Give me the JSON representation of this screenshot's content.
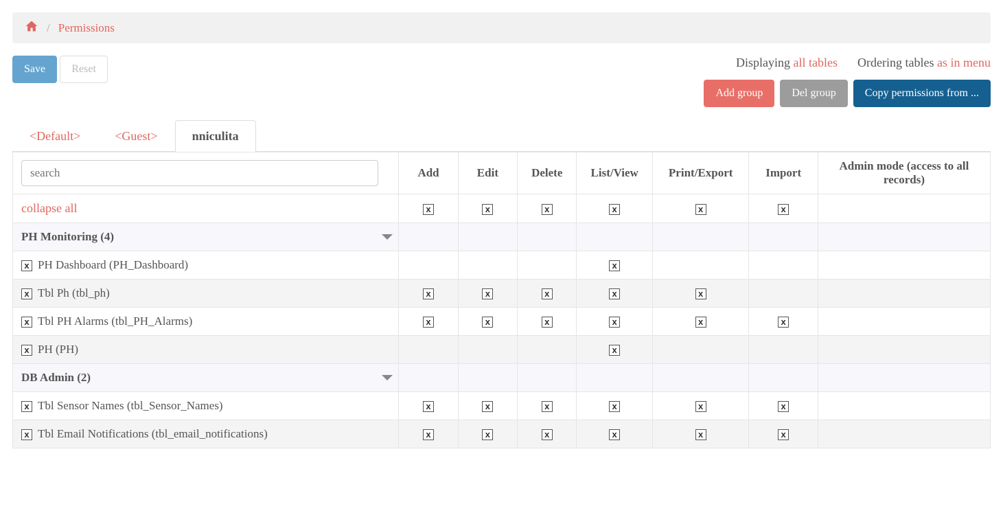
{
  "breadcrumb": {
    "current": "Permissions"
  },
  "toolbar": {
    "save": "Save",
    "reset": "Reset"
  },
  "status": {
    "displaying_label": "Displaying ",
    "displaying_value": "all tables",
    "ordering_label": "Ordering tables ",
    "ordering_value": "as in menu"
  },
  "actions": {
    "add_group": "Add group",
    "del_group": "Del group",
    "copy_from": "Copy permissions from ..."
  },
  "tabs": [
    {
      "label": "<Default>",
      "active": false
    },
    {
      "label": "<Guest>",
      "active": false
    },
    {
      "label": "nniculita",
      "active": true
    }
  ],
  "search": {
    "placeholder": "search"
  },
  "columns": [
    "Add",
    "Edit",
    "Delete",
    "List/View",
    "Print/Export",
    "Import",
    "Admin mode (access to all records)"
  ],
  "collapse_all": "collapse all",
  "header_perms": {
    "add": true,
    "edit": true,
    "delete": true,
    "list": true,
    "print": true,
    "import": true,
    "admin": false
  },
  "groups": [
    {
      "name": "PH Monitoring",
      "count": 4,
      "items": [
        {
          "label": "PH Dashboard (PH_Dashboard)",
          "row_checked": true,
          "perms": {
            "add": false,
            "edit": false,
            "delete": false,
            "list": true,
            "print": false,
            "import": false,
            "admin": false
          }
        },
        {
          "label": "Tbl Ph (tbl_ph)",
          "row_checked": true,
          "perms": {
            "add": true,
            "edit": true,
            "delete": true,
            "list": true,
            "print": true,
            "import": false,
            "admin": false
          }
        },
        {
          "label": "Tbl PH Alarms (tbl_PH_Alarms)",
          "row_checked": true,
          "perms": {
            "add": true,
            "edit": true,
            "delete": true,
            "list": true,
            "print": true,
            "import": true,
            "admin": false
          }
        },
        {
          "label": "PH (PH)",
          "row_checked": true,
          "perms": {
            "add": false,
            "edit": false,
            "delete": false,
            "list": true,
            "print": false,
            "import": false,
            "admin": false
          }
        }
      ]
    },
    {
      "name": "DB Admin",
      "count": 2,
      "items": [
        {
          "label": "Tbl Sensor Names (tbl_Sensor_Names)",
          "row_checked": true,
          "perms": {
            "add": true,
            "edit": true,
            "delete": true,
            "list": true,
            "print": true,
            "import": true,
            "admin": false
          }
        },
        {
          "label": "Tbl Email Notifications (tbl_email_notifications)",
          "row_checked": true,
          "perms": {
            "add": true,
            "edit": true,
            "delete": true,
            "list": true,
            "print": true,
            "import": true,
            "admin": false
          }
        }
      ]
    }
  ]
}
